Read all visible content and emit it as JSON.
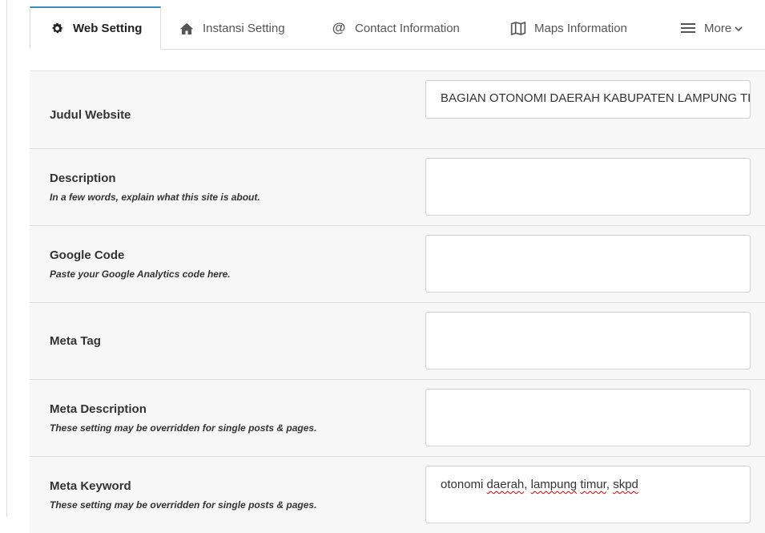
{
  "tabs": [
    {
      "label": "Web Setting",
      "icon": "gear-icon",
      "active": true
    },
    {
      "label": "Instansi Setting",
      "icon": "home-icon",
      "active": false
    },
    {
      "label": "Contact Information",
      "icon": "at-icon",
      "active": false
    },
    {
      "label": "Maps Information",
      "icon": "map-icon",
      "active": false
    },
    {
      "label": "More",
      "icon": "menu-icon",
      "active": false
    }
  ],
  "form": {
    "rows": [
      {
        "label": "Judul Website",
        "hint": "",
        "value": "BAGIAN OTONOMI DAERAH KABUPATEN LAMPUNG TIMUR"
      },
      {
        "label": "Description",
        "hint": "In a few words, explain what this site is about.",
        "value": ""
      },
      {
        "label": "Google Code",
        "hint": "Paste your Google Analytics code here.",
        "value": ""
      },
      {
        "label": "Meta Tag",
        "hint": "",
        "value": ""
      },
      {
        "label": "Meta Description",
        "hint": "These setting may be overridden for single posts & pages.",
        "value": ""
      },
      {
        "label": "Meta Keyword",
        "hint": "These setting may be overridden for single posts & pages.",
        "value_parts": [
          "otonomi ",
          "daerah",
          ", ",
          "lampung",
          " ",
          "timur",
          ", ",
          "skpd"
        ]
      }
    ]
  }
}
